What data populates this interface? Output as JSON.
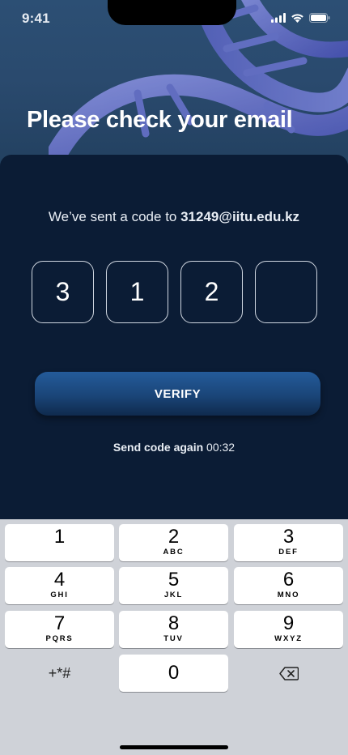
{
  "status_bar": {
    "time": "9:41",
    "icons": [
      "cellular-signal-icon",
      "wifi-icon",
      "battery-icon"
    ]
  },
  "header": {
    "title": "Please check your email"
  },
  "card": {
    "sent_prefix": "We’ve sent a code to ",
    "email": "31249@iitu.edu.kz",
    "otp_digits": [
      "3",
      "1",
      "2",
      ""
    ],
    "verify_label": "VERIFY",
    "resend_label": "Send code again",
    "countdown": "00:32"
  },
  "keyboard": {
    "keys": [
      {
        "digit": "1",
        "letters": ""
      },
      {
        "digit": "2",
        "letters": "ABC"
      },
      {
        "digit": "3",
        "letters": "DEF"
      },
      {
        "digit": "4",
        "letters": "GHI"
      },
      {
        "digit": "5",
        "letters": "JKL"
      },
      {
        "digit": "6",
        "letters": "MNO"
      },
      {
        "digit": "7",
        "letters": "PQRS"
      },
      {
        "digit": "8",
        "letters": "TUV"
      },
      {
        "digit": "9",
        "letters": "WXYZ"
      },
      {
        "digit": "0",
        "letters": ""
      }
    ],
    "symbols_label": "+*#",
    "delete_icon": "backspace-icon"
  },
  "colors": {
    "background": "#0b1a33",
    "card": "#0b1c35",
    "button": "#1a4578",
    "keyboard": "#cfd2d8"
  }
}
